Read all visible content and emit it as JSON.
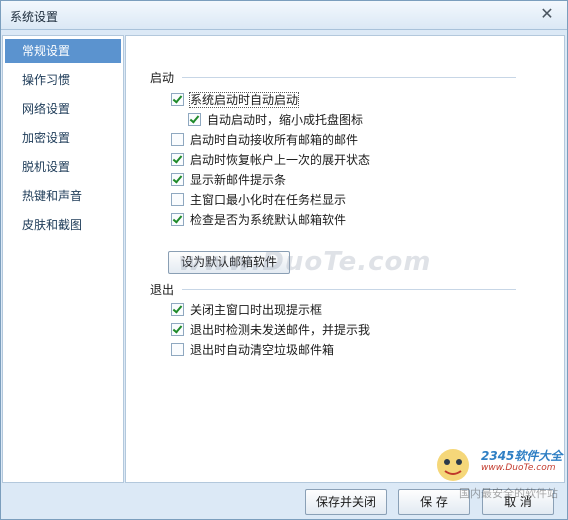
{
  "window": {
    "title": "系统设置"
  },
  "sidebar": {
    "items": [
      {
        "label": "常规设置",
        "active": true
      },
      {
        "label": "操作习惯",
        "active": false
      },
      {
        "label": "网络设置",
        "active": false
      },
      {
        "label": "加密设置",
        "active": false
      },
      {
        "label": "脱机设置",
        "active": false
      },
      {
        "label": "热键和声音",
        "active": false
      },
      {
        "label": "皮肤和截图",
        "active": false
      }
    ]
  },
  "startup": {
    "title": "启动",
    "options": [
      {
        "label": "系统启动时自动启动",
        "checked": true
      },
      {
        "label": "自动启动时，缩小成托盘图标",
        "checked": true
      },
      {
        "label": "启动时自动接收所有邮箱的邮件",
        "checked": false
      },
      {
        "label": "启动时恢复帐户上一次的展开状态",
        "checked": true
      },
      {
        "label": "显示新邮件提示条",
        "checked": true
      },
      {
        "label": "主窗口最小化时在任务栏显示",
        "checked": false
      },
      {
        "label": "检查是否为系统默认邮箱软件",
        "checked": true
      }
    ],
    "default_button": "设为默认邮箱软件"
  },
  "exit": {
    "title": "退出",
    "options": [
      {
        "label": "关闭主窗口时出现提示框",
        "checked": true
      },
      {
        "label": "退出时检测未发送邮件，并提示我",
        "checked": true
      },
      {
        "label": "退出时自动清空垃圾邮件箱",
        "checked": false
      }
    ]
  },
  "footer": {
    "save_close": "保存并关闭",
    "save": "保 存",
    "cancel": "取 消"
  },
  "watermark": "www.DuoTe.com",
  "logo": {
    "brand": "2345软件大全",
    "url": "www.DuoTe.com",
    "slogan": "国内最安全的软件站"
  },
  "colors": {
    "accent": "#5b93cf",
    "check": "#1f8a2a"
  }
}
